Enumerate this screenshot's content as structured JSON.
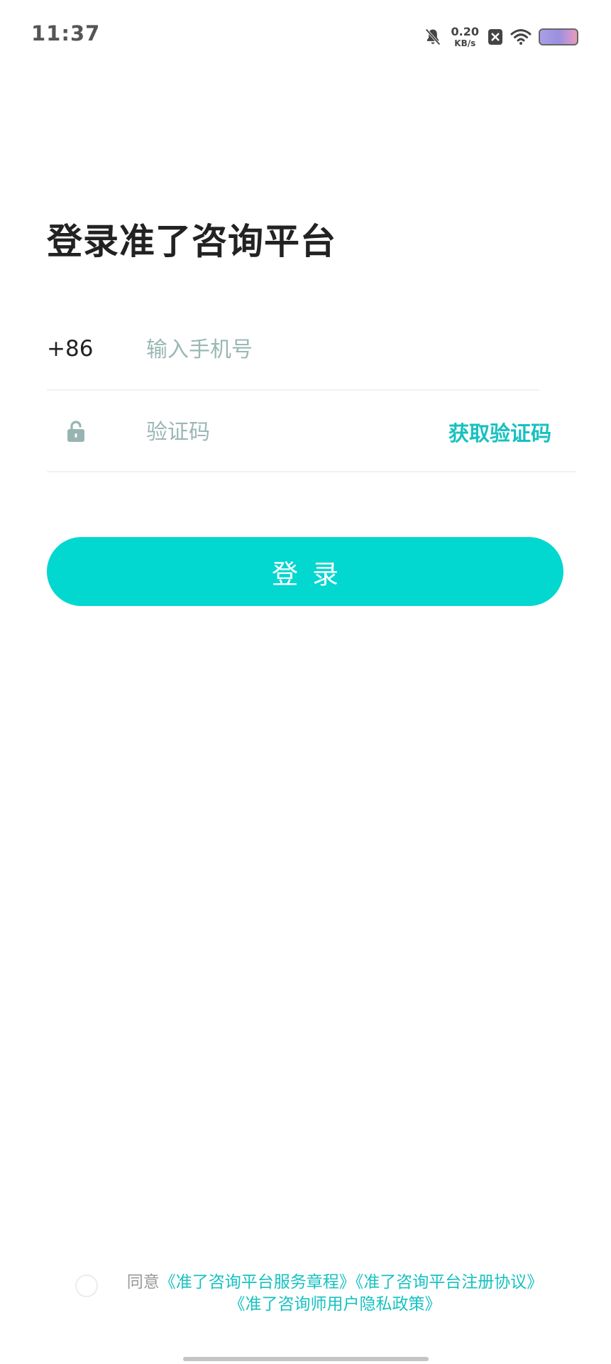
{
  "status_bar": {
    "time": "11:37",
    "speed_value": "0.20",
    "speed_unit": "KB/s",
    "icons": [
      "bell-muted-icon",
      "sim-x-icon",
      "wifi-icon",
      "battery-icon"
    ]
  },
  "page": {
    "title": "登录准了咨询平台"
  },
  "phone": {
    "country_code": "+86",
    "placeholder": "输入手机号"
  },
  "code": {
    "placeholder": "验证码",
    "get_code_label": "获取验证码",
    "icon": "lock-icon"
  },
  "login": {
    "label": "登录"
  },
  "agreement": {
    "prefix": "同意",
    "link_service": "《准了咨询平台服务章程》",
    "link_register": "《准了咨询平台注册协议》",
    "link_privacy": "《准了咨询师用户隐私政策》"
  },
  "colors": {
    "accent": "#02d7d0",
    "link": "#17c1c0",
    "placeholder": "#9ab7b4"
  }
}
